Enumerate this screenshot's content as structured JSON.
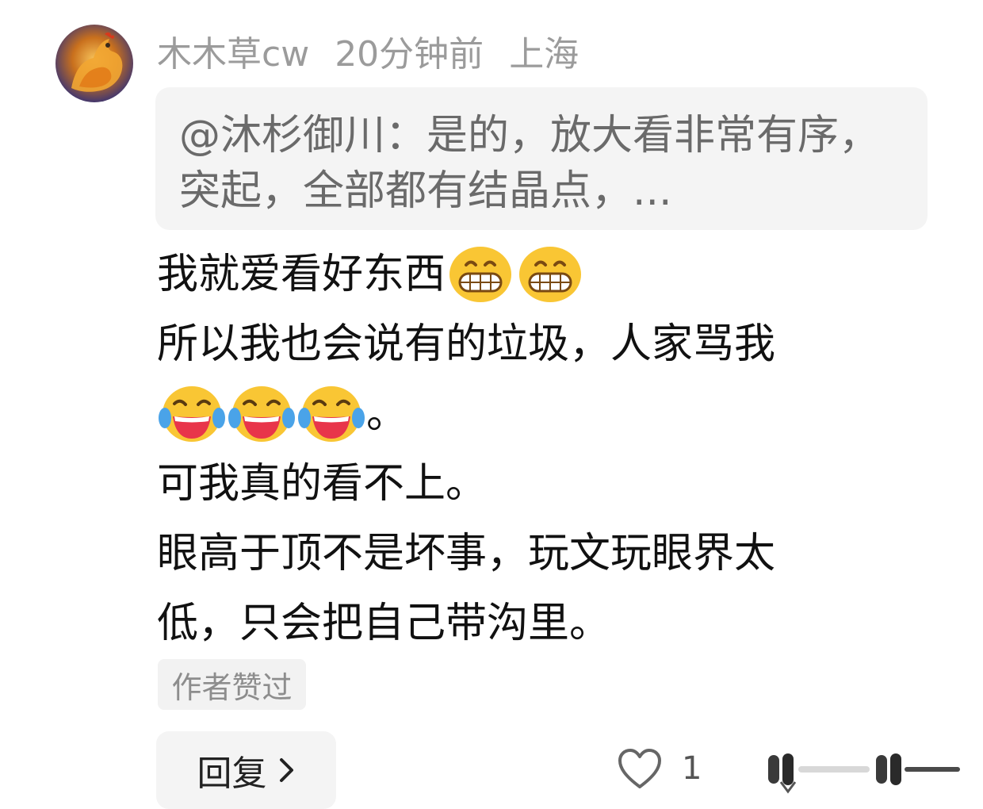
{
  "comment": {
    "username": "木木草cw",
    "time": "20分钟前",
    "location": "上海",
    "quote": "@沐杉御川：是的，放大看非常有序，突起，全部都有结晶点，...",
    "lines": {
      "l1": "我就爱看好东西",
      "l2": "所以我也会说有的垃圾，人家骂我",
      "l3_end": "。",
      "l4": "可我真的看不上。",
      "l5": "眼高于顶不是坏事，玩文玩眼界太",
      "l6": "低，只会把自己带沟里。"
    },
    "emojis": {
      "grin": "grinning-face-icon",
      "laugh": "tears-of-joy-icon"
    },
    "author_liked_badge": "作者赞过"
  },
  "actions": {
    "reply_label": "回复",
    "like_count": "1"
  }
}
